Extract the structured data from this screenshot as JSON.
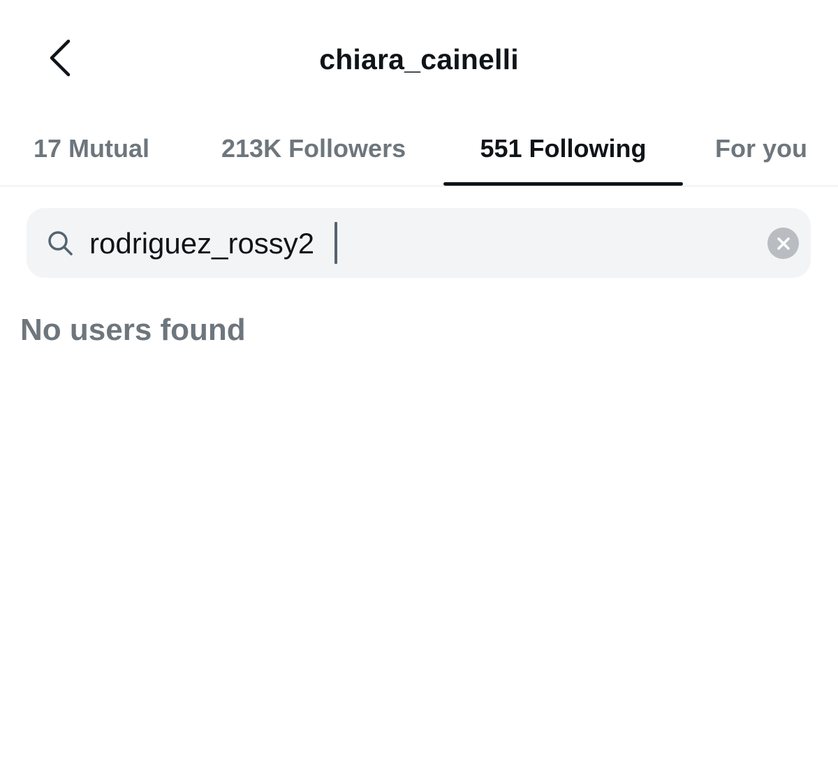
{
  "header": {
    "title": "chiara_cainelli",
    "back_icon": "chevron-left-icon"
  },
  "tabs": [
    {
      "label": "17 Mutual",
      "active": false
    },
    {
      "label": "213K Followers",
      "active": false
    },
    {
      "label": "551 Following",
      "active": true
    },
    {
      "label": "For you",
      "active": false
    }
  ],
  "search": {
    "value": "rodriguez_rossy2",
    "icon": "search-icon",
    "clear_icon": "clear-icon"
  },
  "results": {
    "empty_message": "No users found"
  },
  "colors": {
    "text_primary": "#0f1419",
    "text_secondary": "#6e767d",
    "search_background": "#f3f4f6",
    "clear_button": "#b9bdc2"
  }
}
